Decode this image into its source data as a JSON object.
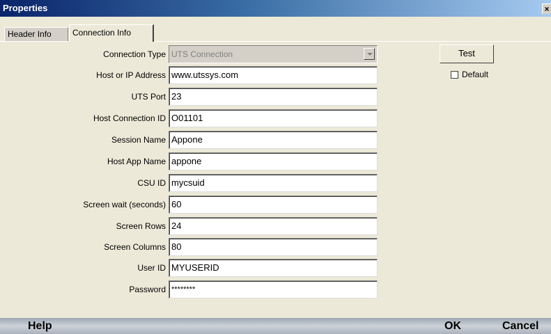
{
  "window": {
    "title": "Properties",
    "close_glyph": "×"
  },
  "tabs": [
    {
      "label": "Header Info",
      "active": false
    },
    {
      "label": "Connection Info",
      "active": true
    }
  ],
  "form": {
    "connection_type": {
      "label": "Connection Type",
      "value": "UTS Connection",
      "disabled": true
    },
    "fields": [
      {
        "label": "Host or IP Address",
        "value": "www.utssys.com"
      },
      {
        "label": "UTS Port",
        "value": "23"
      },
      {
        "label": "Host Connection ID",
        "value": "O01101"
      },
      {
        "label": "Session Name",
        "value": "Appone"
      },
      {
        "label": "Host App Name",
        "value": "appone"
      },
      {
        "label": "CSU ID",
        "value": "mycsuid"
      },
      {
        "label": "Screen wait (seconds)",
        "value": "60"
      },
      {
        "label": "Screen Rows",
        "value": "24"
      },
      {
        "label": "Screen Columns",
        "value": "80"
      },
      {
        "label": "User ID",
        "value": "MYUSERID"
      },
      {
        "label": "Password",
        "value": "********"
      }
    ]
  },
  "side": {
    "test_label": "Test",
    "default_label": "Default",
    "default_checked": false
  },
  "footer": {
    "help_label": "Help",
    "ok_label": "OK",
    "cancel_label": "Cancel"
  },
  "colors": {
    "title_bar_start": "#0a246a",
    "title_bar_end": "#a6caf0",
    "dialog_bg": "#ece9d8"
  }
}
